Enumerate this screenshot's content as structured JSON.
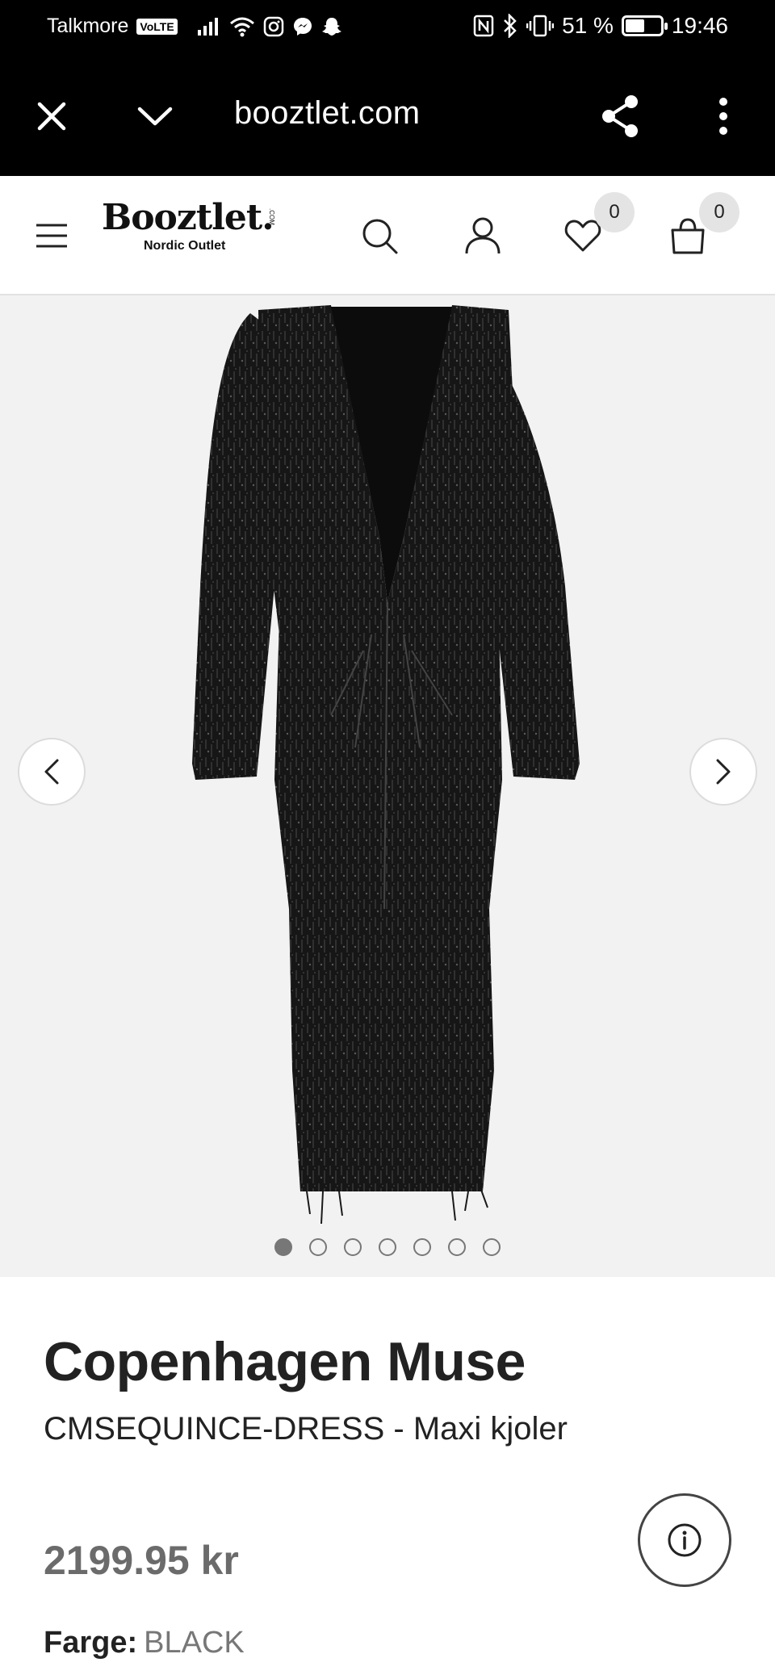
{
  "status_bar": {
    "carrier": "Talkmore",
    "volte": "VoLTE",
    "battery_percent": "51 %",
    "battery_level": 0.51,
    "time": "19:46"
  },
  "browser": {
    "url": "booztlet.com",
    "icons": [
      "close-icon",
      "chevron-down-icon",
      "share-icon",
      "more-vertical-icon"
    ]
  },
  "header": {
    "logo_text": "Booztlet.",
    "logo_com": ".COM",
    "logo_subtitle": "Nordic Outlet",
    "wishlist_count": "0",
    "cart_count": "0",
    "icons": [
      "menu-icon",
      "search-icon",
      "account-icon",
      "heart-icon",
      "bag-icon"
    ]
  },
  "gallery": {
    "image_count": 7,
    "active_index": 0
  },
  "product": {
    "brand": "Copenhagen Muse",
    "name": "CMSEQUINCE-DRESS - Maxi kjoler",
    "price": "2199.95 kr",
    "color_label": "Farge:",
    "color_value": "BLACK"
  },
  "colors": {
    "top_bar": "#000000",
    "gallery_bg": "#f2f2f2",
    "price": "#6b6b6b"
  }
}
